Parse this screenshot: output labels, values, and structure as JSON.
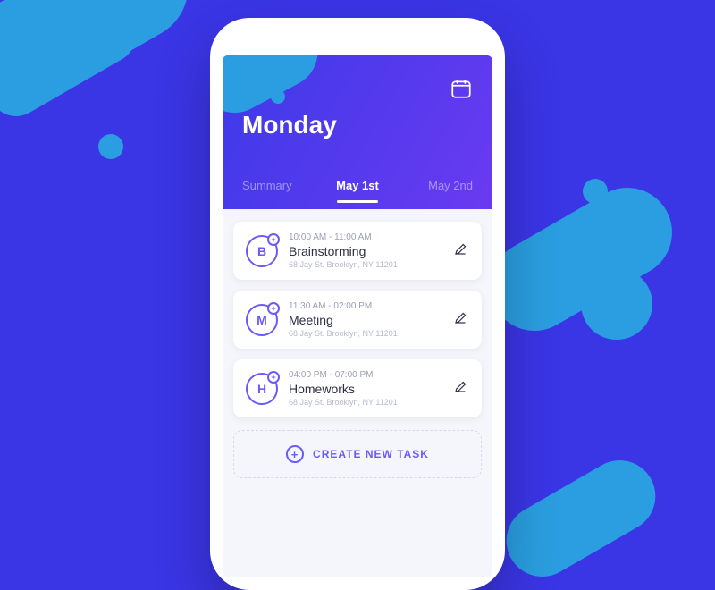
{
  "colors": {
    "bg": "#3a35e5",
    "accent": "#6a5af9",
    "blob": "#2a9ee0"
  },
  "header": {
    "day_title": "Monday",
    "tabs": [
      {
        "label": "Summary",
        "active": false
      },
      {
        "label": "May 1st",
        "active": true
      },
      {
        "label": "May 2nd",
        "active": false
      }
    ],
    "icon": "calendar-icon"
  },
  "tasks": [
    {
      "letter": "B",
      "time": "10:00 AM - 11:00 AM",
      "title": "Brainstorming",
      "location": "68 Jay St. Brooklyn, NY 11201"
    },
    {
      "letter": "M",
      "time": "11:30 AM - 02:00 PM",
      "title": "Meeting",
      "location": "68 Jay St. Brooklyn, NY 11201"
    },
    {
      "letter": "H",
      "time": "04:00 PM - 07:00 PM",
      "title": "Homeworks",
      "location": "68 Jay St. Brooklyn, NY 11201"
    }
  ],
  "create_task_label": "CREATE NEW TASK"
}
